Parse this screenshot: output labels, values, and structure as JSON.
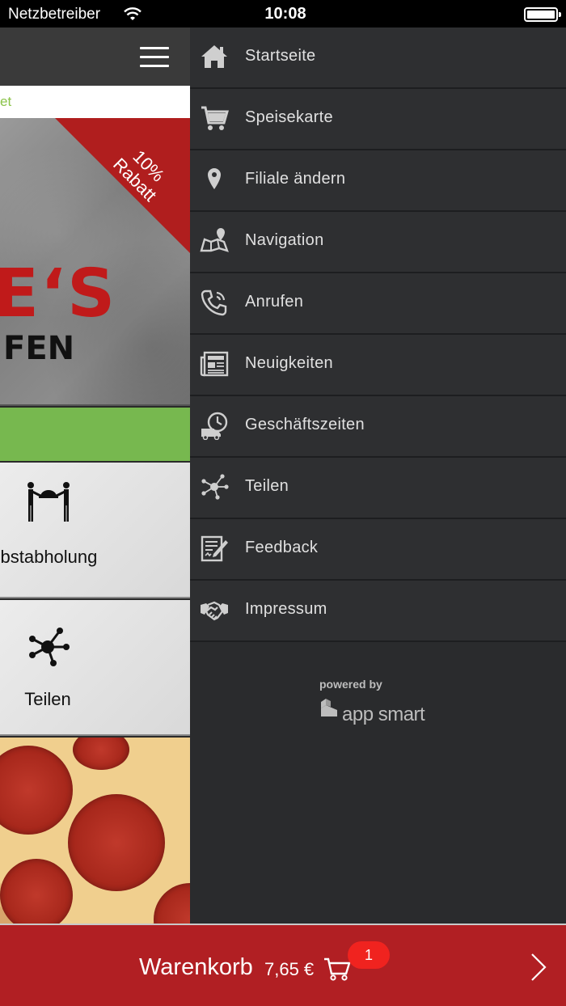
{
  "status_bar": {
    "carrier": "Netzbetreiber",
    "time": "10:08"
  },
  "background_screen": {
    "search_fragment": "et",
    "banner": {
      "ribbon_line1": "10%",
      "ribbon_line2": "Rabatt",
      "logo_big": "E‘S",
      "logo_small": "FEN"
    },
    "tiles": [
      {
        "label": "lbstabholung",
        "icon": "pickup-icon"
      },
      {
        "label": "Teilen",
        "icon": "share-icon"
      }
    ]
  },
  "drawer": {
    "items": [
      {
        "label": "Startseite",
        "icon": "home-icon"
      },
      {
        "label": "Speisekarte",
        "icon": "cart-icon"
      },
      {
        "label": "Filiale ändern",
        "icon": "location-pin-icon"
      },
      {
        "label": "Navigation",
        "icon": "map-icon"
      },
      {
        "label": "Anrufen",
        "icon": "phone-icon"
      },
      {
        "label": "Neuigkeiten",
        "icon": "newspaper-icon"
      },
      {
        "label": "Geschäftszeiten",
        "icon": "delivery-clock-icon"
      },
      {
        "label": "Teilen",
        "icon": "share-icon"
      },
      {
        "label": "Feedback",
        "icon": "feedback-icon"
      },
      {
        "label": "Impressum",
        "icon": "handshake-icon"
      }
    ],
    "powered_by": "powered by",
    "brand": "app smart"
  },
  "cart_bar": {
    "label": "Warenkorb",
    "total": "7,65 €",
    "badge_count": "1"
  },
  "colors": {
    "cart_red": "#b11f23",
    "badge_red": "#f0231f",
    "green_bar": "#77b84f",
    "drawer_bg": "#2e2f31"
  }
}
